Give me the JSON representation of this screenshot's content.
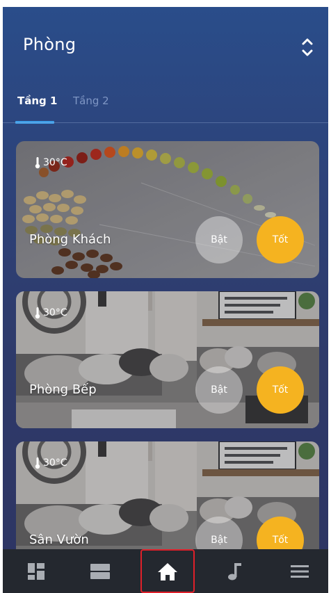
{
  "header": {
    "title": "Phòng",
    "sort_icon": "unfold-icon"
  },
  "tabs": [
    {
      "label": "Tầng 1",
      "active": true
    },
    {
      "label": "Tầng 2",
      "active": false
    }
  ],
  "rooms": [
    {
      "name": "Phòng Khách",
      "temperature": "30°C",
      "on_label": "Bật",
      "off_label": "Tốt"
    },
    {
      "name": "Phòng Bếp",
      "temperature": "30°C",
      "on_label": "Bật",
      "off_label": "Tốt"
    },
    {
      "name": "Sân Vườn",
      "temperature": "30°C",
      "on_label": "Bật",
      "off_label": "Tốt"
    }
  ],
  "bottom_nav": [
    {
      "icon": "dashboard-icon",
      "active": false
    },
    {
      "icon": "layers-icon",
      "active": false
    },
    {
      "icon": "home-icon",
      "active": true
    },
    {
      "icon": "music-note-icon",
      "active": false
    },
    {
      "icon": "menu-icon",
      "active": false
    }
  ],
  "colors": {
    "accent_off_button": "#f5b320",
    "tab_indicator": "#3f9fe8",
    "nav_background": "#24282f",
    "active_nav_outline": "#e0202a"
  }
}
